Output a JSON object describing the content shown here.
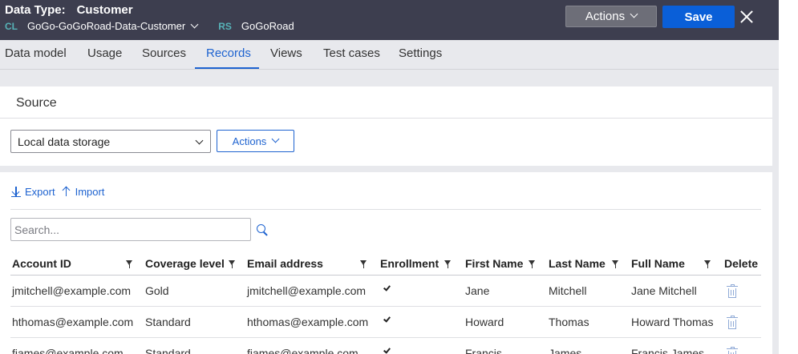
{
  "header": {
    "data_type_label": "Data Type:",
    "data_type_value": "Customer",
    "cl_prefix": "CL",
    "class_name": "GoGo-GoGoRoad-Data-Customer",
    "rs_prefix": "RS",
    "ruleset": "GoGoRoad",
    "actions_label": "Actions",
    "save_label": "Save"
  },
  "tabs": [
    {
      "label": "Data model"
    },
    {
      "label": "Usage"
    },
    {
      "label": "Sources"
    },
    {
      "label": "Records",
      "active": true
    },
    {
      "label": "Views"
    },
    {
      "label": "Test cases"
    },
    {
      "label": "Settings"
    }
  ],
  "source": {
    "title": "Source",
    "storage_value": "Local data storage",
    "actions_label": "Actions"
  },
  "records": {
    "export_label": "Export",
    "import_label": "Import",
    "search_placeholder": "Search...",
    "columns": [
      "Account ID",
      "Coverage level",
      "Email address",
      "Enrollment",
      "First Name",
      "Last Name",
      "Full Name",
      "Delete"
    ],
    "rows": [
      {
        "account_id": "jmitchell@example.com",
        "coverage": "Gold",
        "email": "jmitchell@example.com",
        "enrollment": true,
        "first": "Jane",
        "last": "Mitchell",
        "full": "Jane Mitchell"
      },
      {
        "account_id": "hthomas@example.com",
        "coverage": "Standard",
        "email": "hthomas@example.com",
        "enrollment": true,
        "first": "Howard",
        "last": "Thomas",
        "full": "Howard Thomas"
      },
      {
        "account_id": "fjames@example.com",
        "coverage": "Standard",
        "email": "fjames@example.com",
        "enrollment": true,
        "first": "Francis",
        "last": "James",
        "full": "Francis James"
      }
    ]
  },
  "colors": {
    "header_bg": "#3d3e4f",
    "accent": "#1e63d0",
    "save_bg": "#0a5fd8",
    "prefix": "#57b3b8"
  }
}
